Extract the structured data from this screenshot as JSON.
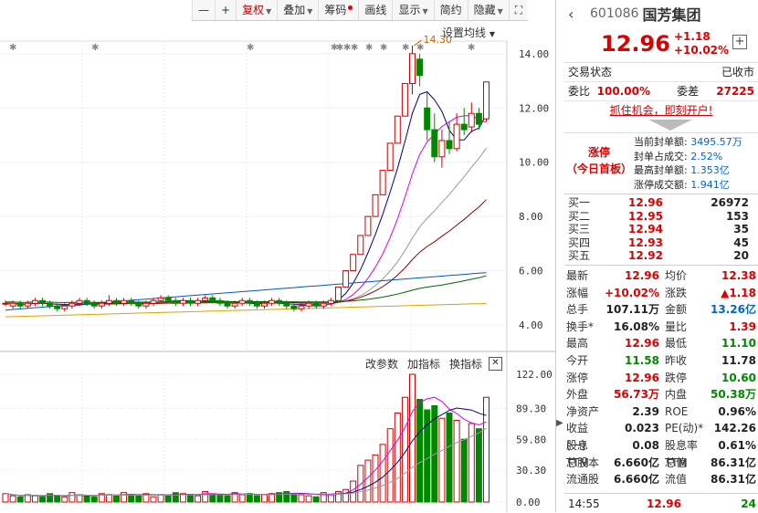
{
  "toolbar": {
    "items": [
      {
        "label": "—"
      },
      {
        "label": "+"
      },
      {
        "label": "复权",
        "dropdown": true,
        "active": true
      },
      {
        "label": "叠加",
        "dropdown": true
      },
      {
        "label": "筹码",
        "dot": true
      },
      {
        "label": "画线"
      },
      {
        "label": "显示",
        "dropdown": true
      },
      {
        "label": "简约"
      },
      {
        "label": "隐藏",
        "dropdown": true
      }
    ],
    "fullscreen_icon": "fullscreen-icon"
  },
  "chart": {
    "ma_settings_label": "设置均线",
    "high_annotation": "14.30",
    "price_ticks": [
      "14.00",
      "12.00",
      "10.00",
      "8.00",
      "6.00",
      "4.00"
    ],
    "volume_ticks": [
      "122.00",
      "89.30",
      "59.80",
      "30.30",
      "0.00"
    ],
    "volume_tools": [
      "改参数",
      "加指标",
      "换指标"
    ]
  },
  "chart_data": {
    "type": "candlestick",
    "price_axis": {
      "min": 4,
      "max": 14.5
    },
    "candles": [
      [
        4.8,
        4.8,
        4.9,
        4.7
      ],
      [
        4.7,
        4.8,
        4.9,
        4.6
      ],
      [
        4.8,
        4.7,
        4.9,
        4.6
      ],
      [
        4.7,
        4.8,
        4.9,
        4.6
      ],
      [
        4.8,
        4.9,
        5.0,
        4.7
      ],
      [
        4.9,
        4.8,
        5.0,
        4.7
      ],
      [
        4.8,
        4.7,
        4.9,
        4.6
      ],
      [
        4.7,
        4.6,
        4.8,
        4.5
      ],
      [
        4.6,
        4.7,
        4.8,
        4.5
      ],
      [
        4.7,
        4.8,
        4.9,
        4.6
      ],
      [
        4.8,
        4.9,
        5.0,
        4.7
      ],
      [
        4.9,
        4.8,
        5.0,
        4.7
      ],
      [
        4.8,
        4.7,
        4.9,
        4.6
      ],
      [
        4.7,
        4.8,
        4.9,
        4.6
      ],
      [
        4.8,
        4.9,
        5.1,
        4.7
      ],
      [
        4.9,
        4.8,
        5.0,
        4.7
      ],
      [
        4.8,
        4.9,
        5.0,
        4.7
      ],
      [
        4.9,
        4.8,
        5.0,
        4.7
      ],
      [
        4.8,
        4.7,
        4.9,
        4.6
      ],
      [
        4.7,
        4.8,
        4.9,
        4.6
      ],
      [
        4.8,
        4.9,
        5.0,
        4.7
      ],
      [
        4.9,
        5.0,
        5.1,
        4.8
      ],
      [
        5.0,
        4.9,
        5.1,
        4.8
      ],
      [
        4.9,
        4.8,
        5.0,
        4.7
      ],
      [
        4.8,
        4.9,
        5.0,
        4.7
      ],
      [
        4.9,
        4.8,
        5.0,
        4.7
      ],
      [
        4.8,
        4.9,
        5.0,
        4.7
      ],
      [
        4.9,
        5.0,
        5.1,
        4.8
      ],
      [
        5.0,
        4.9,
        5.1,
        4.8
      ],
      [
        4.9,
        4.8,
        5.0,
        4.7
      ],
      [
        4.8,
        4.7,
        4.9,
        4.6
      ],
      [
        4.7,
        4.8,
        4.9,
        4.6
      ],
      [
        4.8,
        4.9,
        5.0,
        4.7
      ],
      [
        4.9,
        4.8,
        5.0,
        4.7
      ],
      [
        4.8,
        4.7,
        4.9,
        4.6
      ],
      [
        4.7,
        4.8,
        4.9,
        4.6
      ],
      [
        4.8,
        4.9,
        5.0,
        4.7
      ],
      [
        4.9,
        4.8,
        5.0,
        4.7
      ],
      [
        4.8,
        4.7,
        4.9,
        4.6
      ],
      [
        4.7,
        4.6,
        4.8,
        4.5
      ],
      [
        4.6,
        4.7,
        4.8,
        4.5
      ],
      [
        4.7,
        4.8,
        4.9,
        4.6
      ],
      [
        4.8,
        4.7,
        4.9,
        4.6
      ],
      [
        4.7,
        4.8,
        4.9,
        4.6
      ],
      [
        4.8,
        4.9,
        5.0,
        4.7
      ],
      [
        4.9,
        5.4,
        5.4,
        4.9
      ],
      [
        5.4,
        6.0,
        6.0,
        5.4
      ],
      [
        6.0,
        6.6,
        6.6,
        6.0
      ],
      [
        6.6,
        7.3,
        7.3,
        6.6
      ],
      [
        7.3,
        8.0,
        8.0,
        7.3
      ],
      [
        8.0,
        8.8,
        8.8,
        8.0
      ],
      [
        8.8,
        9.7,
        9.7,
        8.8
      ],
      [
        9.7,
        10.7,
        10.7,
        9.7
      ],
      [
        10.7,
        11.7,
        11.7,
        10.7
      ],
      [
        11.7,
        12.9,
        12.9,
        11.7
      ],
      [
        12.9,
        14.0,
        14.3,
        12.5
      ],
      [
        13.8,
        13.2,
        14.0,
        12.8
      ],
      [
        12.0,
        11.2,
        12.6,
        10.8
      ],
      [
        11.2,
        10.2,
        11.8,
        10.0
      ],
      [
        10.2,
        10.8,
        11.2,
        9.8
      ],
      [
        10.8,
        10.5,
        11.5,
        10.3
      ],
      [
        10.5,
        11.4,
        11.8,
        10.4
      ],
      [
        11.4,
        11.2,
        12.0,
        11.0
      ],
      [
        11.3,
        11.8,
        12.2,
        11.1
      ],
      [
        11.8,
        11.4,
        12.0,
        11.2
      ],
      [
        11.6,
        12.96,
        12.96,
        11.5
      ]
    ],
    "volumes": [
      8,
      6,
      5,
      7,
      6,
      5,
      8,
      6,
      5,
      9,
      7,
      6,
      5,
      8,
      7,
      6,
      9,
      7,
      6,
      8,
      5,
      7,
      6,
      9,
      8,
      7,
      6,
      10,
      8,
      7,
      6,
      9,
      7,
      8,
      6,
      7,
      8,
      9,
      10,
      8,
      7,
      6,
      5,
      9,
      7,
      10,
      12,
      20,
      35,
      40,
      45,
      55,
      70,
      85,
      100,
      122,
      98,
      88,
      92,
      80,
      85,
      78,
      60,
      75,
      70,
      100
    ]
  },
  "stock": {
    "code": "601086",
    "name": "国芳集团",
    "price": "12.96",
    "change": "+1.18",
    "change_pct": "+10.02%"
  },
  "status": {
    "label": "交易状态",
    "value": "已收市",
    "weibi_label": "委比",
    "weibi_value": "100.00%",
    "weicha_label": "委差",
    "weicha_value": "27225"
  },
  "promo": "抓住机会，即刻开户!",
  "limit": {
    "label_line1": "涨停",
    "label_line2": "（今日首板）",
    "rows": [
      {
        "k": "当前封单额:",
        "v": "3495.57万"
      },
      {
        "k": "封单占成交:",
        "v": "2.52%"
      },
      {
        "k": "最高封单额:",
        "v": "1.353亿"
      },
      {
        "k": "涨停成交额:",
        "v": "1.941亿"
      }
    ]
  },
  "orderbook": [
    {
      "label": "买一",
      "price": "12.96",
      "qty": "26972"
    },
    {
      "label": "买二",
      "price": "12.95",
      "qty": "153"
    },
    {
      "label": "买三",
      "price": "12.94",
      "qty": "35"
    },
    {
      "label": "买四",
      "price": "12.93",
      "qty": "45"
    },
    {
      "label": "买五",
      "price": "12.92",
      "qty": "20"
    }
  ],
  "stats": [
    {
      "k1": "最新",
      "v1": "12.96",
      "c1": "red",
      "k2": "均价",
      "v2": "12.38",
      "c2": "red"
    },
    {
      "k1": "涨幅",
      "v1": "+10.02%",
      "c1": "red",
      "k2": "涨跌",
      "v2": "▲1.18",
      "c2": "red"
    },
    {
      "k1": "总手",
      "v1": "107.11万",
      "c1": "",
      "k2": "金额",
      "v2": "13.26亿",
      "c2": "blue"
    },
    {
      "k1": "换手*",
      "v1": "16.08%",
      "c1": "",
      "k2": "量比",
      "v2": "1.39",
      "c2": "red"
    },
    {
      "k1": "最高",
      "v1": "12.96",
      "c1": "red",
      "k2": "最低",
      "v2": "11.10",
      "c2": "green"
    },
    {
      "k1": "今开",
      "v1": "11.58",
      "c1": "green",
      "k2": "昨收",
      "v2": "11.78",
      "c2": ""
    },
    {
      "k1": "涨停",
      "v1": "12.96",
      "c1": "red",
      "k2": "跌停",
      "v2": "10.60",
      "c2": "green"
    },
    {
      "k1": "外盘",
      "v1": "56.73万",
      "c1": "red",
      "k2": "内盘",
      "v2": "50.38万",
      "c2": "green"
    },
    {
      "k1": "净资产",
      "v1": "2.39",
      "c1": "",
      "k2": "ROE",
      "v2": "0.96%",
      "c2": ""
    },
    {
      "k1": "收益(一)",
      "v1": "0.023",
      "c1": "",
      "k2": "PE(动)*",
      "v2": "142.26",
      "c2": ""
    },
    {
      "k1": "股息TTM",
      "v1": "0.08",
      "c1": "",
      "k2": "股息率TTM",
      "v2": "0.61%",
      "c2": ""
    },
    {
      "k1": "总股本",
      "v1": "6.660亿",
      "c1": "",
      "k2": "总值",
      "v2": "86.31亿",
      "c2": ""
    },
    {
      "k1": "流通股",
      "v1": "6.660亿",
      "c1": "",
      "k2": "流值",
      "v2": "86.31亿",
      "c2": ""
    }
  ],
  "footer": {
    "time": "14:55",
    "price": "12.96",
    "vol": "24"
  },
  "colors": {
    "up": "#d00000",
    "down": "#008800",
    "ma5": "#000080",
    "ma10": "#e000e0",
    "ma20": "#999999",
    "ma30": "#990000",
    "ma60": "#006600",
    "ma120": "#0055cc",
    "ma250": "#e0a000"
  }
}
